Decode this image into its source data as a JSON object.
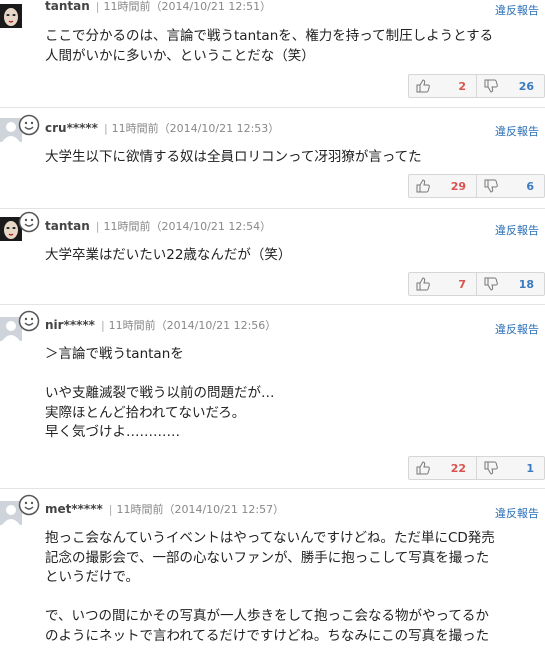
{
  "report_label": "違反報告",
  "comments": [
    {
      "user": "tantan",
      "time": "11時間前（2014/10/21 12:51）",
      "avatar": "mask-icon",
      "lines": [
        "ここで分かるのは、言論で戦うtantanを、権力を持って制圧しようとする",
        "人間がいかに多いか、ということだな（笑）"
      ],
      "good": "2",
      "bad": "26"
    },
    {
      "user": "cru*****",
      "time": "11時間前（2014/10/21 12:53）",
      "avatar": "default-avatar-icon",
      "lines": [
        "大学生以下に欲情する奴は全員ロリコンって冴羽獠が言ってた"
      ],
      "good": "29",
      "bad": "6"
    },
    {
      "user": "tantan",
      "time": "11時間前（2014/10/21 12:54）",
      "avatar": "mask-icon",
      "lines": [
        "大学卒業はだいたい22歳なんだが（笑）"
      ],
      "good": "7",
      "bad": "18"
    },
    {
      "user": "nir*****",
      "time": "11時間前（2014/10/21 12:56）",
      "avatar": "default-avatar-icon",
      "lines": [
        "＞言論で戦うtantanを",
        "",
        "いや支離滅裂で戦う以前の問題だが…",
        "実際ほとんど拾われてないだろ。",
        "早く気づけよ…………"
      ],
      "good": "22",
      "bad": "1"
    },
    {
      "user": "met*****",
      "time": "11時間前（2014/10/21 12:57）",
      "avatar": "default-avatar-icon",
      "lines": [
        "抱っこ会なんていうイベントはやってないんですけどね。ただ単にCD発売",
        "記念の撮影会で、一部の心ないファンが、勝手に抱っこして写真を撮った",
        "というだけで。",
        "",
        "で、いつの間にかその写真が一人歩きをして抱っこ会なる物がやってるか",
        "のようにネットで言われてるだけですけどね。ちなみにこの写真を撮った"
      ],
      "good": "",
      "bad": ""
    }
  ]
}
